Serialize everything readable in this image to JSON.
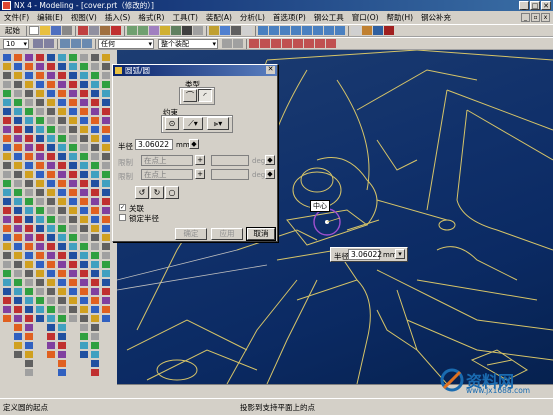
{
  "window": {
    "title": "NX 4 - Modeling - [cover.prt（修改的）]",
    "buttons": [
      "_",
      "□",
      "✕"
    ]
  },
  "menu": {
    "items": [
      "文件(F)",
      "编辑(E)",
      "视图(V)",
      "插入(S)",
      "格式(R)",
      "工具(T)",
      "装配(A)",
      "分析(L)",
      "首选项(P)",
      "钢公工具",
      "窗口(O)",
      "帮助(H)",
      "钢公补充"
    ]
  },
  "toolbar": {
    "start_label": "起始",
    "filter_value": "任何",
    "assembly_value": "整个装配",
    "scale_value": "10"
  },
  "dialog": {
    "title": "圆弧/圆",
    "type_label": "类型",
    "constraint_label": "约束",
    "radius_label": "半径",
    "radius_value": "3.06022",
    "radius_unit": "mm",
    "limit1_label": "限制",
    "limit1_value": "在点上",
    "limit2_label": "限制",
    "limit2_value": "在点上",
    "angle_unit": "deg",
    "associative_label": "关联",
    "associative_checked": true,
    "lock_radius_label": "锁定半径",
    "lock_radius_checked": false,
    "ok_label": "确定",
    "apply_label": "应用",
    "cancel_label": "取消"
  },
  "viewport": {
    "center_label": "中心",
    "radius_label": "半径",
    "radius_value": "3.06022",
    "radius_unit": "mm"
  },
  "status": {
    "left": "定义圆的起点",
    "middle": "投影到支持平面上的点"
  },
  "watermark": {
    "text": "资料网",
    "url": "www.jx1688.com"
  }
}
